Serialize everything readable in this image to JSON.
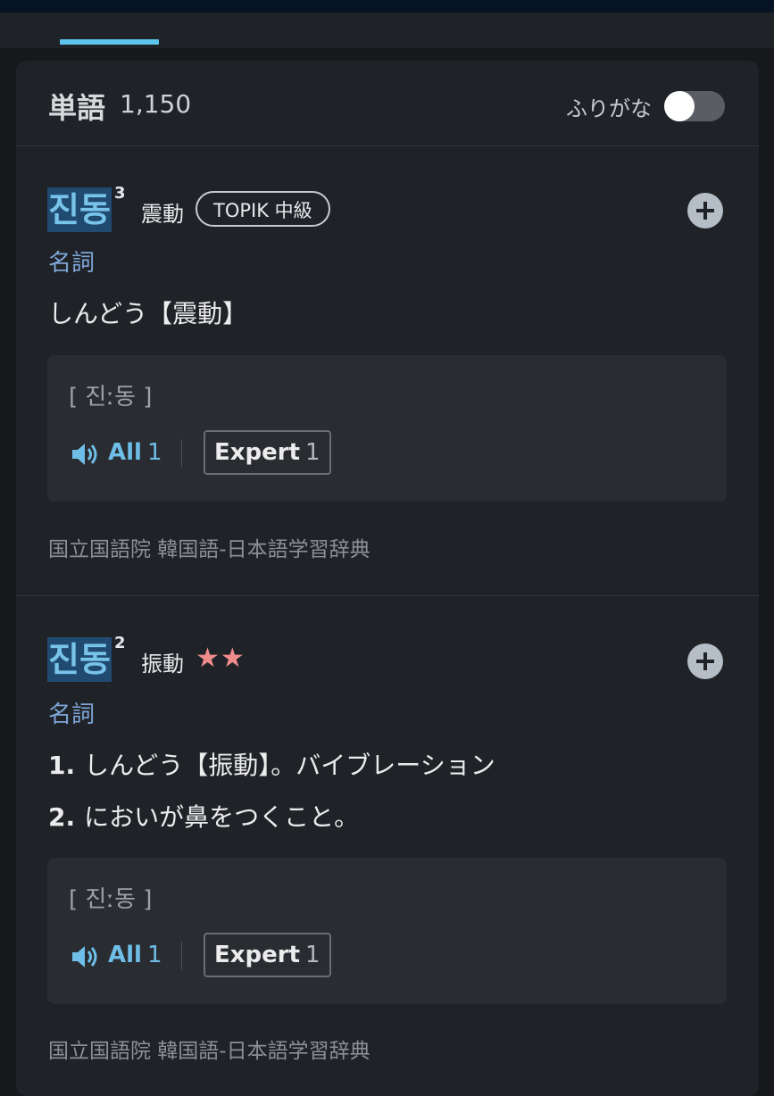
{
  "header": {
    "title": "単語",
    "count": "1,150",
    "furigana_label": "ふりがな",
    "furigana_enabled": false
  },
  "entries": [
    {
      "word": "진동",
      "superscript": "3",
      "hanja": "震動",
      "badge": "TOPIK 中級",
      "stars": "",
      "part_of_speech": "名詞",
      "meanings": [
        {
          "num": "",
          "text": "しんどう【震動】"
        }
      ],
      "pronunciation": "[ 진ː동 ]",
      "audio": {
        "all_label": "All",
        "all_count": "1",
        "expert_label": "Expert",
        "expert_count": "1"
      },
      "source": "国立国語院 韓国語-日本語学習辞典"
    },
    {
      "word": "진동",
      "superscript": "2",
      "hanja": "振動",
      "badge": "",
      "stars": "★★",
      "part_of_speech": "名詞",
      "meanings": [
        {
          "num": "1.",
          "text": "しんどう【振動】。バイブレーション"
        },
        {
          "num": "2.",
          "text": "においが鼻をつくこと。"
        }
      ],
      "pronunciation": "[ 진ː동 ]",
      "audio": {
        "all_label": "All",
        "all_count": "1",
        "expert_label": "Expert",
        "expert_count": "1"
      },
      "source": "国立国語院 韓国語-日本語学習辞典"
    }
  ],
  "icons": {
    "add": "plus-circle-icon",
    "speaker": "speaker-icon"
  },
  "colors": {
    "accent": "#5cc6ec",
    "highlight_bg": "#204a70",
    "star": "#f08b8b",
    "pos": "#7ea6d8"
  }
}
